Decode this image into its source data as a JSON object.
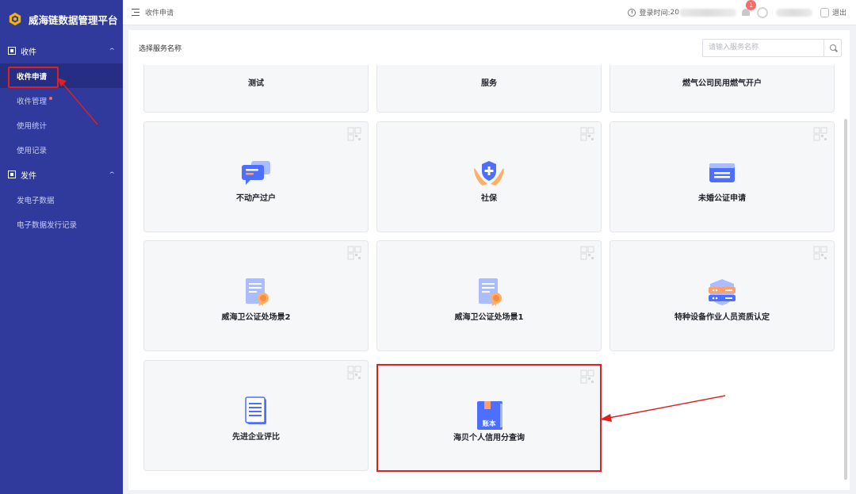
{
  "app": {
    "title": "威海链数据管理平台"
  },
  "sidebar": {
    "groups": [
      {
        "label": "收件",
        "items": [
          {
            "label": "收件申请",
            "active": true
          },
          {
            "label": "收件管理",
            "dot": true
          },
          {
            "label": "使用统计"
          },
          {
            "label": "使用记录"
          }
        ]
      },
      {
        "label": "发件",
        "items": [
          {
            "label": "发电子数据"
          },
          {
            "label": "电子数据发行记录"
          }
        ]
      }
    ]
  },
  "header": {
    "breadcrumb": "收件申请",
    "login_label": "登录时间:",
    "login_value": "20",
    "notification_count": "1",
    "logout_label": "退出"
  },
  "main": {
    "section_label": "选择服务名称",
    "search": {
      "placeholder": "请输入服务名称",
      "value": ""
    },
    "cards": [
      {
        "title": "测试",
        "icon": "cert-icon"
      },
      {
        "title": "服务",
        "icon": "cert-icon"
      },
      {
        "title": "燃气公司民用燃气开户",
        "icon": "cert-icon"
      },
      {
        "title": "不动产过户",
        "icon": "chat-icon"
      },
      {
        "title": "社保",
        "icon": "shield-hands-icon"
      },
      {
        "title": "未婚公证申请",
        "icon": "card-icon"
      },
      {
        "title": "威海卫公证处场景2",
        "icon": "certificate-icon"
      },
      {
        "title": "威海卫公证处场景1",
        "icon": "certificate-icon"
      },
      {
        "title": "特种设备作业人员资质认定",
        "icon": "server-shield-icon"
      },
      {
        "title": "先进企业评比",
        "icon": "document-icon"
      },
      {
        "title": "海贝个人信用分查询",
        "icon": "ledger-book-icon",
        "icon_text": "账本"
      }
    ]
  },
  "colors": {
    "sidebar_bg": "#2f3a9c",
    "accent_blue": "#4d6fff",
    "highlight_red": "#e02020"
  }
}
